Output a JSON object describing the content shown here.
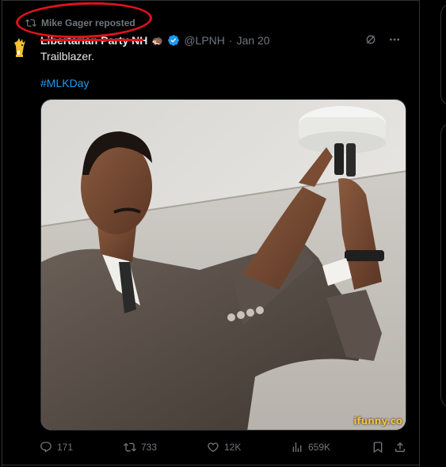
{
  "repost": {
    "icon": "repost-icon",
    "text": "Mike Gager reposted"
  },
  "author": {
    "display_name": "Libertarian Party NH",
    "emoji": "🦔",
    "verified": true,
    "handle": "@LPNH",
    "separator": "·",
    "date": "Jan 20"
  },
  "tweet": {
    "text": "Trailblazer.",
    "hashtag": "#MLKDay"
  },
  "media": {
    "watermark": "ifunny.co"
  },
  "actions": {
    "replies": "171",
    "reposts": "733",
    "likes": "12K",
    "views": "659K"
  },
  "colors": {
    "background": "#000000",
    "text": "#e7e9ea",
    "muted": "#71767b",
    "link": "#1d9bf0",
    "verified": "#1d9bf0",
    "annotation": "#e0121b",
    "divider": "#2f3336"
  }
}
